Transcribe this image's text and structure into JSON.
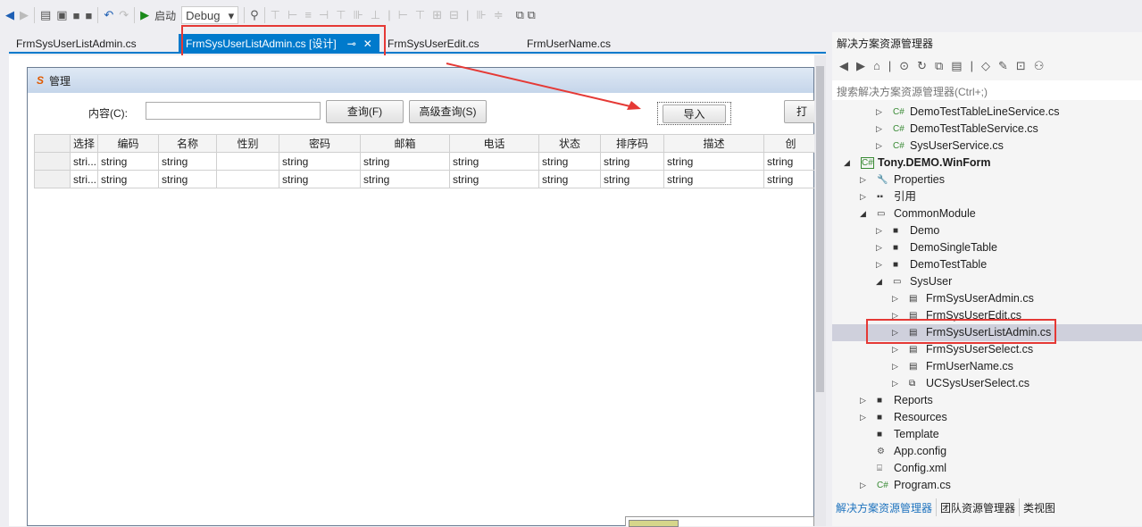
{
  "toolbar": {
    "start_label": "启动",
    "config": "Debug"
  },
  "tabs": [
    {
      "label": "FrmSysUserListAdmin.cs"
    },
    {
      "label": "FrmSysUserListAdmin.cs [设计]",
      "active": true
    },
    {
      "label": "FrmSysUserEdit.cs"
    },
    {
      "label": "FrmUserName.cs"
    }
  ],
  "form": {
    "title": "管理",
    "content_label": "内容(C):",
    "content_value": "",
    "query_button": "查询(F)",
    "advanced_button": "高级查询(S)",
    "import_button": "导入",
    "print_button": "打",
    "columns": [
      "选择",
      "编码",
      "名称",
      "性别",
      "密码",
      "邮箱",
      "电话",
      "状态",
      "排序码",
      "描述",
      "创"
    ],
    "rows": [
      [
        "stri...",
        "string",
        "string",
        "",
        "string",
        "string",
        "string",
        "string",
        "string",
        "string",
        "string"
      ],
      [
        "stri...",
        "string",
        "string",
        "",
        "string",
        "string",
        "string",
        "string",
        "string",
        "string",
        "string"
      ]
    ]
  },
  "solution_explorer": {
    "title": "解决方案资源管理器",
    "search_placeholder": "搜索解决方案资源管理器(Ctrl+;)",
    "items": [
      {
        "label": "DemoTestTableLineService.cs",
        "level": 2,
        "icon": "csharp",
        "chevron": "collapsed"
      },
      {
        "label": "DemoTestTableService.cs",
        "level": 2,
        "icon": "csharp",
        "chevron": "collapsed"
      },
      {
        "label": "SysUserService.cs",
        "level": 2,
        "icon": "csharp",
        "chevron": "collapsed"
      },
      {
        "label": "Tony.DEMO.WinForm",
        "level": 0,
        "icon": "csharp-project",
        "chevron": "expanded",
        "bold": true
      },
      {
        "label": "Properties",
        "level": 1,
        "icon": "wrench",
        "chevron": "collapsed"
      },
      {
        "label": "引用",
        "level": 1,
        "icon": "references",
        "chevron": "collapsed"
      },
      {
        "label": "CommonModule",
        "level": 1,
        "icon": "folder-open",
        "chevron": "expanded"
      },
      {
        "label": "Demo",
        "level": 2,
        "icon": "folder",
        "chevron": "collapsed"
      },
      {
        "label": "DemoSingleTable",
        "level": 2,
        "icon": "folder",
        "chevron": "collapsed"
      },
      {
        "label": "DemoTestTable",
        "level": 2,
        "icon": "folder",
        "chevron": "collapsed"
      },
      {
        "label": "SysUser",
        "level": 2,
        "icon": "folder-open",
        "chevron": "expanded"
      },
      {
        "label": "FrmSysUserAdmin.cs",
        "level": 3,
        "icon": "form",
        "chevron": "collapsed"
      },
      {
        "label": "FrmSysUserEdit.cs",
        "level": 3,
        "icon": "form",
        "chevron": "collapsed"
      },
      {
        "label": "FrmSysUserListAdmin.cs",
        "level": 3,
        "icon": "form",
        "chevron": "collapsed",
        "selected": true
      },
      {
        "label": "FrmSysUserSelect.cs",
        "level": 3,
        "icon": "form",
        "chevron": "collapsed"
      },
      {
        "label": "FrmUserName.cs",
        "level": 3,
        "icon": "form",
        "chevron": "collapsed"
      },
      {
        "label": "UCSysUserSelect.cs",
        "level": 3,
        "icon": "user-control",
        "chevron": "collapsed"
      },
      {
        "label": "Reports",
        "level": 1,
        "icon": "folder",
        "chevron": "collapsed"
      },
      {
        "label": "Resources",
        "level": 1,
        "icon": "folder",
        "chevron": "collapsed"
      },
      {
        "label": "Template",
        "level": 1,
        "icon": "folder",
        "chevron": "none"
      },
      {
        "label": "App.config",
        "level": 1,
        "icon": "config",
        "chevron": "none"
      },
      {
        "label": "Config.xml",
        "level": 1,
        "icon": "xml",
        "chevron": "none"
      },
      {
        "label": "Program.cs",
        "level": 1,
        "icon": "csharp",
        "chevron": "collapsed"
      }
    ],
    "bottom_tabs": [
      "解决方案资源管理器",
      "团队资源管理器",
      "类视图"
    ]
  },
  "colors": {
    "accent": "#007acc",
    "highlight": "#e53935",
    "selection": "#cfd0dc"
  }
}
